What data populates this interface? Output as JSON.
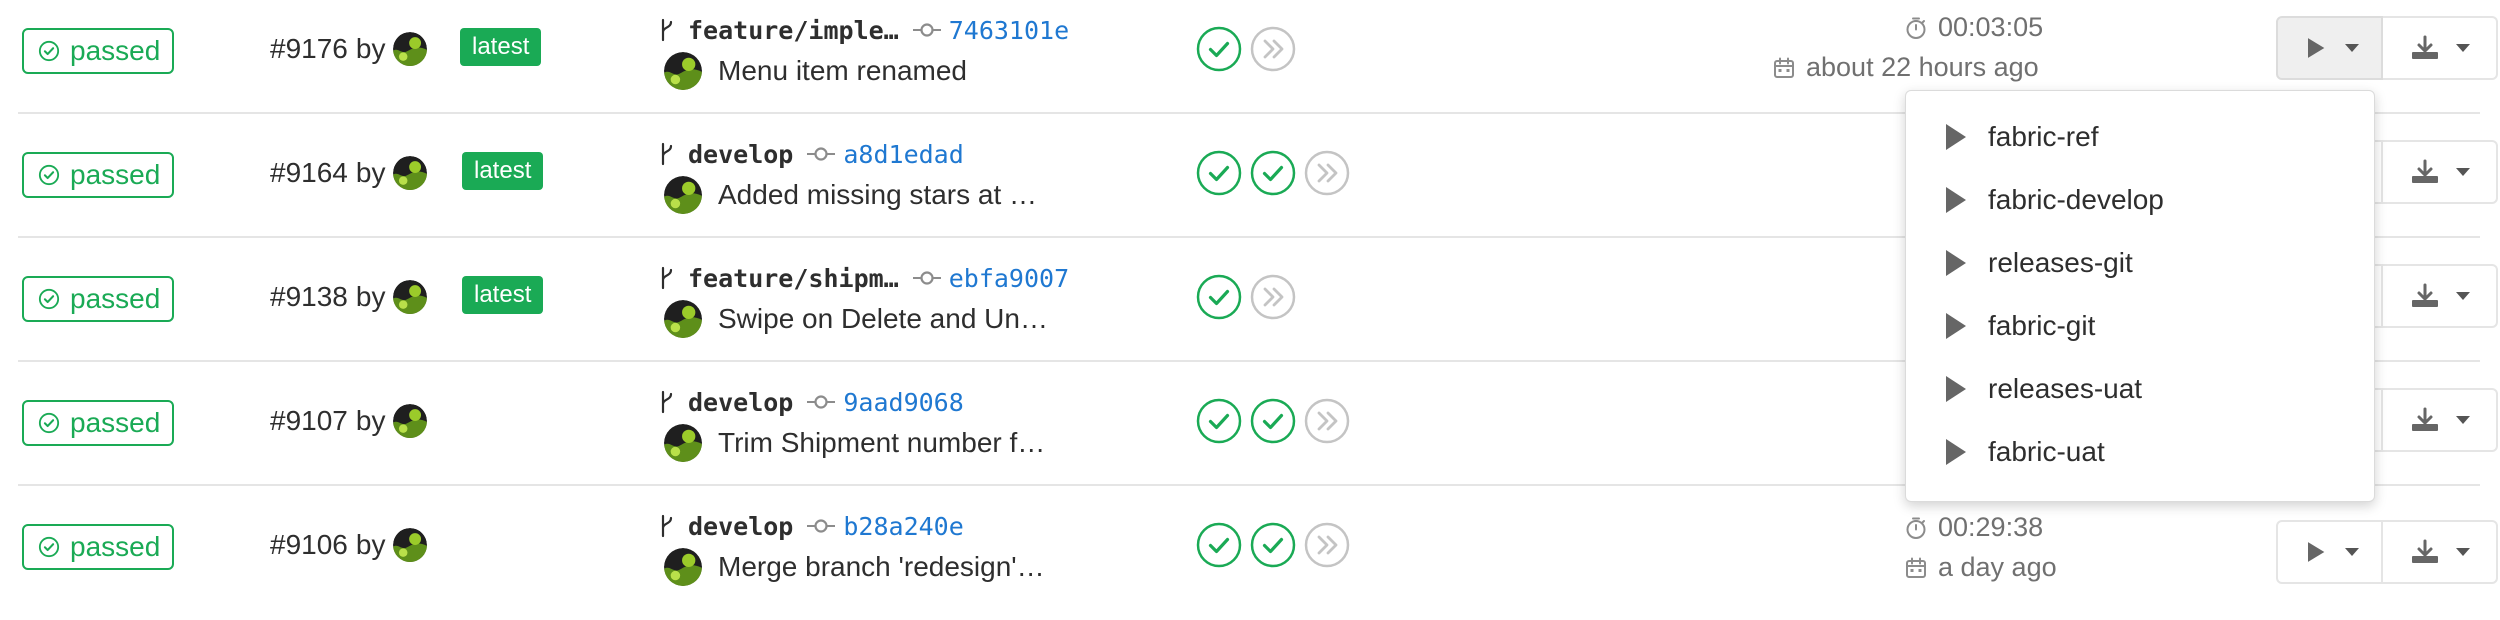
{
  "colors": {
    "success": "#1aaa55",
    "link": "#1f78d1",
    "muted": "#707070",
    "border": "#e5e5e5"
  },
  "icons": {
    "status": "check-circle-icon",
    "branch": "fork-icon",
    "commit": "commit-icon",
    "stage_passed": "check-circle-icon",
    "stage_skipped": "double-chevron-right-icon",
    "duration": "timer-icon",
    "finished": "calendar-icon",
    "play": "play-icon",
    "download": "download-icon",
    "dropdown": "caret-down-icon"
  },
  "pipelines": [
    {
      "status": "passed",
      "id": "#9176",
      "by": "by",
      "latest": "latest",
      "ref": "feature/imple…",
      "sha": "7463101e",
      "message": "Menu item renamed",
      "stages": [
        "passed",
        "skipped"
      ],
      "duration": "00:03:05",
      "finished": "about 22 hours ago"
    },
    {
      "status": "passed",
      "id": "#9164",
      "by": "by",
      "latest": "latest",
      "ref": "develop",
      "sha": "a8d1edad",
      "message": "Added missing stars at …",
      "stages": [
        "passed",
        "passed",
        "skipped"
      ]
    },
    {
      "status": "passed",
      "id": "#9138",
      "by": "by",
      "latest": "latest",
      "ref": "feature/shipm…",
      "sha": "ebfa9007",
      "message": "Swipe on Delete and Un…",
      "stages": [
        "passed",
        "skipped"
      ]
    },
    {
      "status": "passed",
      "id": "#9107",
      "by": "by",
      "ref": "develop",
      "sha": "9aad9068",
      "message": "Trim Shipment number f…",
      "stages": [
        "passed",
        "passed",
        "skipped"
      ]
    },
    {
      "status": "passed",
      "id": "#9106",
      "by": "by",
      "ref": "develop",
      "sha": "b28a240e",
      "message": "Merge branch 'redesign'…",
      "stages": [
        "passed",
        "passed",
        "skipped"
      ],
      "duration": "00:29:38",
      "finished": "a day ago"
    }
  ],
  "manual_actions": [
    "fabric-ref",
    "fabric-develop",
    "releases-git",
    "fabric-git",
    "releases-uat",
    "fabric-uat"
  ]
}
